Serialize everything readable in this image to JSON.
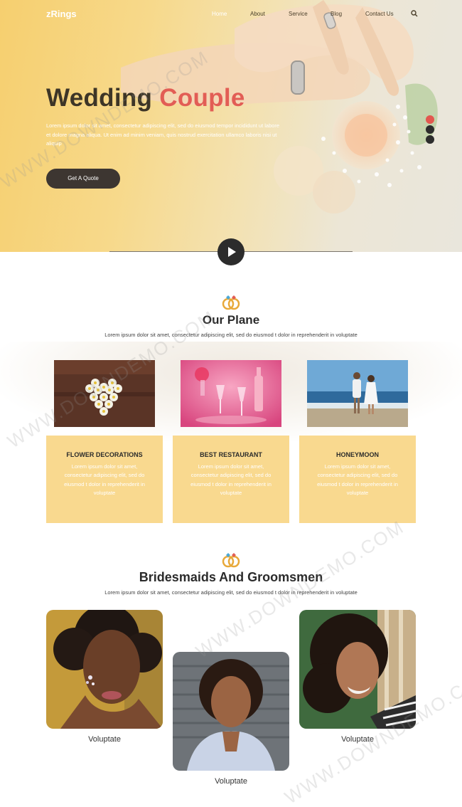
{
  "nav": {
    "logo": "zRings",
    "links": [
      "Home",
      "About",
      "Service",
      "Blog",
      "Contact Us"
    ]
  },
  "hero": {
    "title_part1": "Wedding",
    "title_part2": "Couple",
    "description": "Lorem ipsum dolor sit amet, consectetur adipiscing elit, sed do eiusmod tempor incididunt ut labore et dolore magna aliqua. Ut enim ad minim veniam, quis nostrud exercitation ullamco laboris nisi ut aliquip",
    "cta_label": "Get A Quote"
  },
  "plan": {
    "title": "Our Plane",
    "subtitle": "Lorem ipsum dolor sit amet, consectetur adipiscing elit, sed do eiusmod t dolor in reprehenderit in voluptate",
    "cards": [
      {
        "title": "FLOWER DECORATIONS",
        "text": "Lorem ipsum dolor sit amet, consectetur adipiscing elit, sed do eiusmod t dolor in reprehenderit in voluptate"
      },
      {
        "title": "BEST RESTAURANT",
        "text": "Lorem ipsum dolor sit amet, consectetur adipiscing elit, sed do eiusmod t dolor in reprehenderit in voluptate"
      },
      {
        "title": "HONEYMOON",
        "text": "Lorem ipsum dolor sit amet, consectetur adipiscing elit, sed do eiusmod t dolor in reprehenderit in voluptate"
      }
    ]
  },
  "team": {
    "title": "Bridesmaids And Groomsmen",
    "subtitle": "Lorem ipsum dolor sit amet, consectetur adipiscing elit, sed do eiusmod t dolor in reprehenderit in voluptate",
    "members": [
      {
        "name": "Voluptate"
      },
      {
        "name": "Voluptate"
      },
      {
        "name": "Voluptate"
      }
    ]
  },
  "watermark": "WWW.DOWNDEMO.COM",
  "colors": {
    "accent": "#e25d55",
    "card_yellow": "#f9d98f",
    "dark": "#3d3631"
  },
  "icons": [
    "search-icon",
    "play-icon",
    "rings-icon"
  ]
}
